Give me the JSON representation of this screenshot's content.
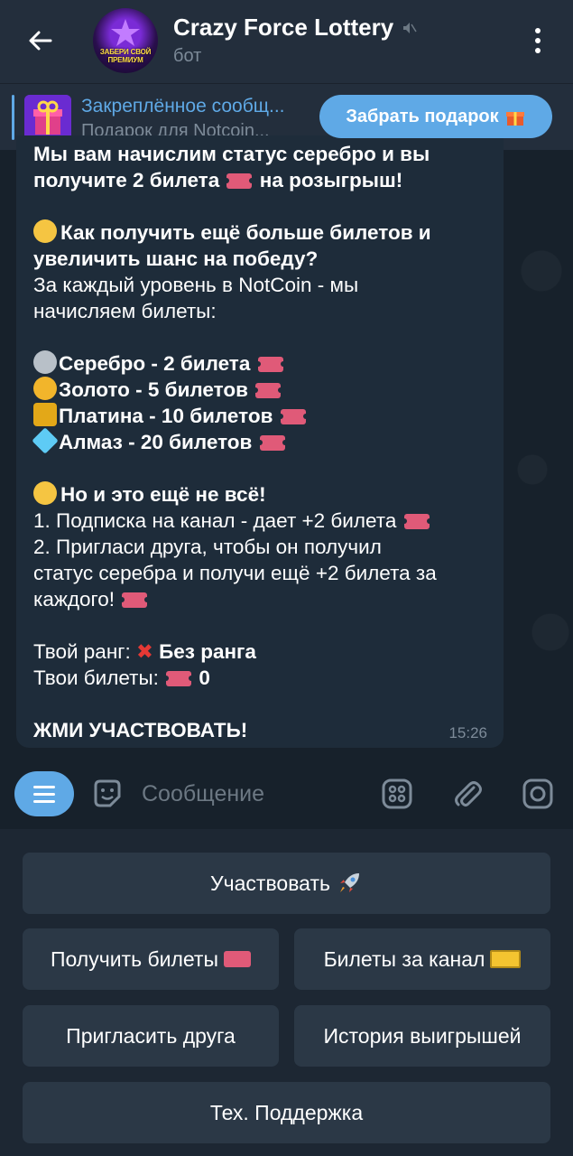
{
  "header": {
    "title": "Crazy Force Lottery",
    "subtitle": "бот",
    "avatar_text": "ЗАБЕРИ СВОЙ ПРЕМИУМ"
  },
  "pinned": {
    "title": "Закреплённое сообщ...",
    "text": "Подарок для Notcoin...",
    "button_label": "Забрать подарок"
  },
  "message": {
    "line1": "Мы вам начислим статус серебро и вы",
    "line2a": "получите 2 билета",
    "line2b": "на розыгрыш!",
    "how_more_a": "Как получить ещё больше билетов и",
    "how_more_b": "увеличить шанс на победу?",
    "per_level_a": "За каждый уровень в NotCoin - мы",
    "per_level_b": "начисляем билеты:",
    "silver": "Серебро - 2 билета",
    "gold": "Золото - 5 билетов",
    "platinum": "Платина - 10 билетов",
    "diamond": "Алмаз - 20 билетов",
    "not_all": "Но и это ещё не всё!",
    "item1": "1. Подписка на канал - дает +2 билета",
    "item2a": "2. Пригласи друга, чтобы он получил",
    "item2b": "статус серебра и получи ещё +2 билета за",
    "item2c": "каждого!",
    "rank_label": "Твой ранг:",
    "rank_value": "Без ранга",
    "tickets_label": "Твои билеты:",
    "tickets_value": "0",
    "cta": "ЖМИ УЧАСТВОВАТЬ!",
    "time": "15:26"
  },
  "composer": {
    "placeholder": "Сообщение"
  },
  "keyboard": {
    "participate": "Участвовать",
    "get_tickets": "Получить билеты",
    "channel_tickets": "Билеты за канал",
    "invite_friend": "Пригласить друга",
    "win_history": "История выигрышей",
    "support": "Тех. Поддержка"
  },
  "colors": {
    "accent": "#5fa9e6",
    "header_bg": "#232e3c",
    "bubble_bg": "#1e2c3a",
    "button_bg": "#2b3846"
  }
}
